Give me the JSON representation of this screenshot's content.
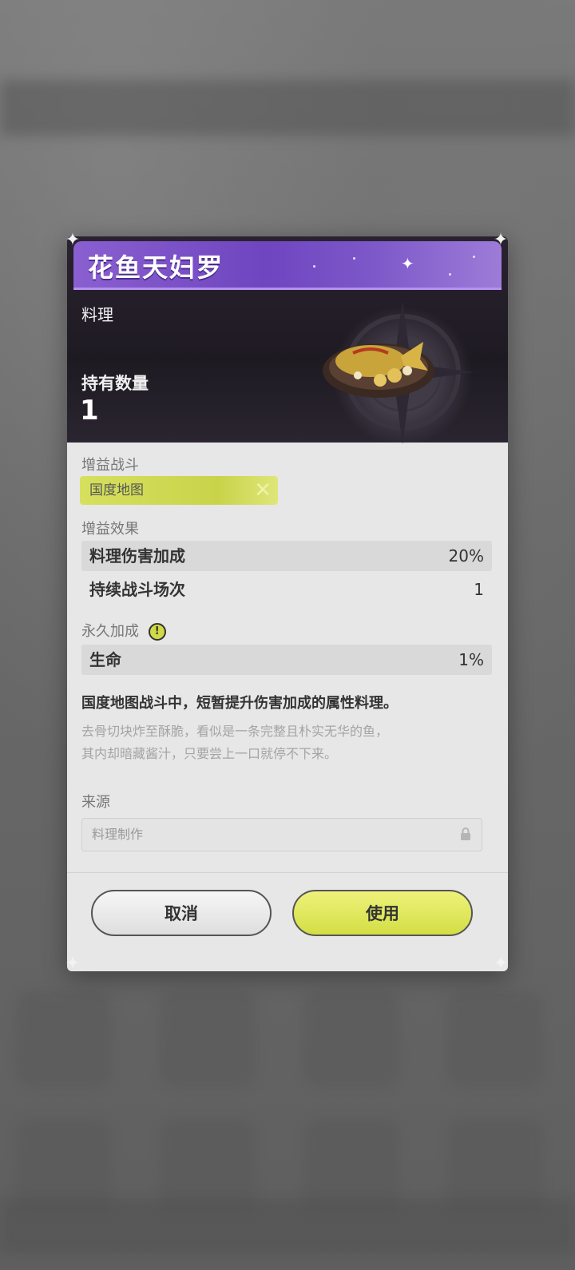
{
  "dialog": {
    "title": "花鱼天妇罗",
    "category": "料理",
    "quantity_label": "持有数量",
    "quantity_value": "1",
    "battle_label": "增益战斗",
    "battle_tag": "国度地图",
    "effect_label": "增益效果",
    "effects": [
      {
        "name": "料理伤害加成",
        "value": "20%"
      },
      {
        "name": "持续战斗场次",
        "value": "1"
      }
    ],
    "permanent_label": "永久加成",
    "permanent": [
      {
        "name": "生命",
        "value": "1%"
      }
    ],
    "description": "国度地图战斗中，短暂提升伤害加成的属性料理。",
    "lore_line1": "去骨切块炸至酥脆，看似是一条完整且朴实无华的鱼，",
    "lore_line2": "其内却暗藏酱汁，只要尝上一口就停不下来。",
    "source_label": "来源",
    "source_value": "料理制作",
    "cancel_label": "取消",
    "use_label": "使用"
  },
  "icons": {
    "info": "info-icon",
    "lock": "lock-icon",
    "sparkle": "sparkle-icon"
  },
  "colors": {
    "title_bar": "#7a52c8",
    "accent": "#d3de45",
    "header_bg": "#1e1a22"
  }
}
